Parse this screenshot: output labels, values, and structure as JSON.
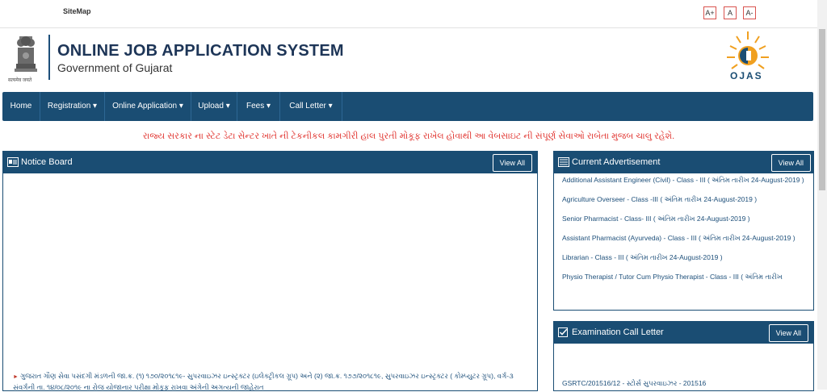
{
  "top": {
    "sitemap": "SiteMap",
    "font_buttons": [
      "A+",
      "A",
      "A-"
    ]
  },
  "header": {
    "title": "ONLINE JOB APPLICATION SYSTEM",
    "subtitle": "Government of Gujarat",
    "emblem_caption": "सत्यमेव जयते",
    "logo_text": "OJAS"
  },
  "nav": {
    "items": [
      "Home",
      "Registration",
      "Online Application",
      "Upload",
      "Fees",
      "Call Letter"
    ]
  },
  "marquee": "રાજ્ય સરકાર ના સ્ટેટ ડેટા સેન્ટર ખાતે ની ટેકનીકલ કામગીરી હાલ પુરતી મોકૂફ રાખેલ હોવાથી આ વેબસાઇટ ની સંપૂર્ણ સેવાઓ રાબેતા મુજબ ચાલુ રહેશે.",
  "notice_board": {
    "title": "Notice Board",
    "view_all": "View All",
    "items": [
      "ગુજરાત ગૌણ સેવા પસંદગી મંડળની જા.ક્ર. (૧) ૧૭૦/૨૦૧૮૧૯- સુપરવાઇઝર ઇન્સ્ટ્રક્ટર (ઇલેક્ટ્રીકલ ગ્રૂપ) અને (૨) જા.ક્ર. ૧૭૭/૨૦૧૮૧૯, સુપરવાઇઝર ઇન્સ્ટ્રક્ટર ( કોમ્પ્યુટર ગ્રૂપ), વર્ગ-૩ સંવર્ગની તા. ૧૪/૦૮/૨૦૧૯ ના રોજ યોજાનાર પરીક્ષા મોકૂફ રાખવા અંગેની અગત્યની જાહેરાત"
    ]
  },
  "current_ads": {
    "title": "Current Advertisement",
    "view_all": "View All",
    "items": [
      "Additional Assistant Engineer (Civil) - Class - III ( અંતિમ તારીખ 24-August-2019 )",
      "Agriculture Overseer - Class -III ( અંતિમ તારીખ 24-August-2019 )",
      "Senior Pharmacist - Class- III ( અંતિમ તારીખ 24-August-2019 )",
      "Assistant Pharmacist (Ayurveda) - Class - III ( અંતિમ તારીખ 24-August-2019 )",
      "Librarian - Class - III ( અંતિમ તારીખ 24-August-2019 )",
      "Physio Therapist / Tutor Cum Physio Therapist - Class - III ( અંતિમ તારીખ"
    ]
  },
  "exam_call": {
    "title": "Examination Call Letter",
    "view_all": "View All",
    "items": [
      "GSRTC/201516/12 - સ્ટોર્સ સુપરવાઇઝર - 201516"
    ]
  },
  "colors": {
    "navy": "#1a4d73",
    "alert_red": "#e0302b",
    "link_blue": "#1d4f7a"
  }
}
